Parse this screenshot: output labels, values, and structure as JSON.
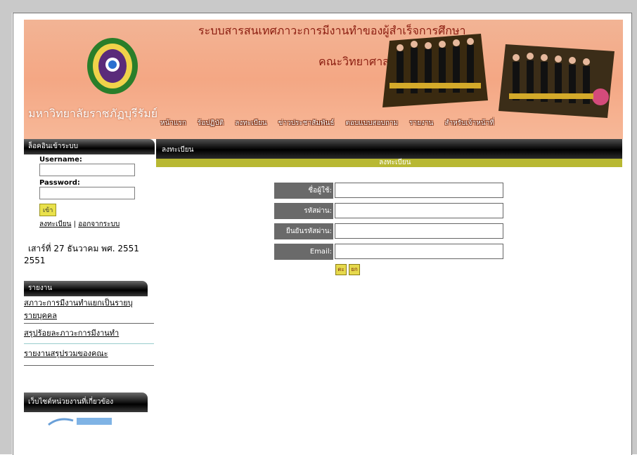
{
  "header": {
    "university_name": "มหาวิทยาลัยราชภัฏบุรีรัมย์",
    "title_line1": "ระบบสารสนเทศภาวะการมีงานทำของผู้สำเร็จการศึกษา",
    "title_line2": "คณะวิทยาศาสตร์"
  },
  "menu": {
    "items": [
      "หน้าแรก",
      "ร้อปฏิบัติ",
      "ลงทะเบียน",
      "ข่าวประชาสัมพันธ์",
      "ตอบแบบสอบถาม",
      "รายงาน",
      "สำหรับเจ้าหน้าที่"
    ]
  },
  "login": {
    "heading": "ล็อคอินเข้าระบบ",
    "username_label": "Username:",
    "password_label": "Password:",
    "submit_label": "เข้า",
    "register_link": "ลงทะเบียน",
    "separator": "|",
    "logout_link": "ออกจากระบบ",
    "date": "เสาร์ที่ 27 ธันวาคม พศ. 2551",
    "date_year": "2551"
  },
  "reports": {
    "heading": "รายงาน",
    "links": [
      "สภาวะการมีงานทำแยกเป็นรายบุ",
      "รายบุคคล",
      "สรุปร้อยละภาวะการมีงานทำ",
      "รายงานสรุปรวมของคณะ"
    ]
  },
  "related": {
    "heading": "เว็บไซต์หน่วยงานที่เกี่ยวข้อง"
  },
  "content": {
    "header": "ลงทะเบียน",
    "subheader": "ลงทะเบียน",
    "fields": [
      "ชื่อผู้ใช้:",
      "รหัสผ่าน:",
      "ยืนยันรหัสผ่าน:",
      "Email:"
    ],
    "buttons": [
      "ตะ",
      "ยก"
    ]
  }
}
